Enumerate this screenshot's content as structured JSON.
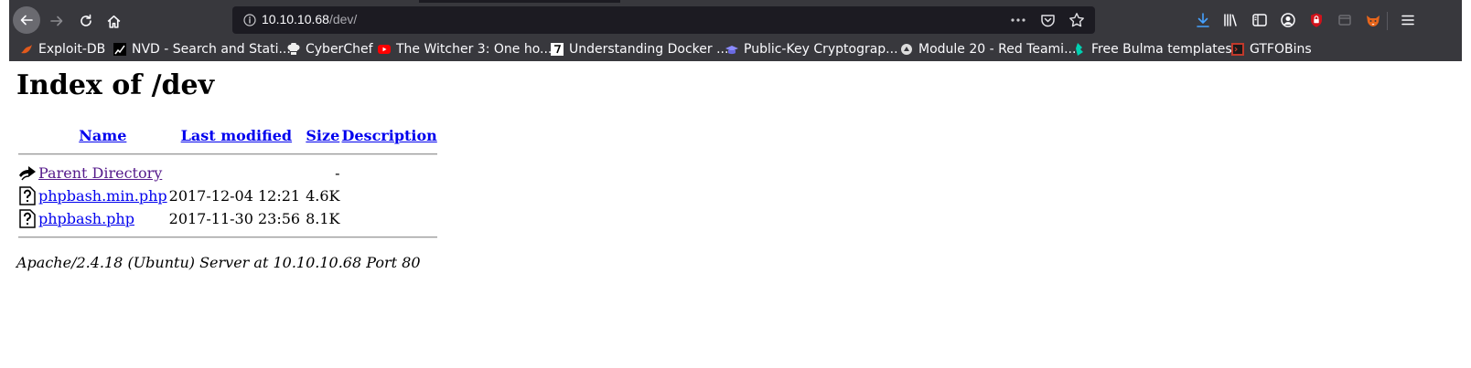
{
  "browser": {
    "url_host": "10.10.10.68",
    "url_path": "/dev/",
    "bookmarks": [
      {
        "label": "Exploit-DB",
        "icon": "exploit-db-icon",
        "color": "#e25a1c"
      },
      {
        "label": "NVD - Search and Stati...",
        "icon": "nvd-icon",
        "color": "#ffffff"
      },
      {
        "label": "CyberChef",
        "icon": "cyberchef-icon",
        "color": "#ffffff"
      },
      {
        "label": "The Witcher 3: One ho...",
        "icon": "youtube-icon",
        "color": "#ff0000"
      },
      {
        "label": "Understanding Docker ...",
        "icon": "medium-icon",
        "color": "#ffffff"
      },
      {
        "label": "Public-Key Cryptograp...",
        "icon": "graduation-cap-icon",
        "color": "#8a8aff"
      },
      {
        "label": "Module 20 - Red Teami...",
        "icon": "module-icon",
        "color": "#dddddd"
      },
      {
        "label": "Free Bulma templates",
        "icon": "bulma-icon",
        "color": "#00d1b2"
      },
      {
        "label": "GTFOBins",
        "icon": "gtfobins-icon",
        "color": "#c0392b"
      }
    ]
  },
  "page": {
    "title": "Index of /dev",
    "columns": {
      "name": "Name",
      "modified": "Last modified",
      "size": "Size",
      "description": "Description"
    },
    "rows": [
      {
        "name": "Parent Directory",
        "modified": "",
        "size": "-",
        "description": "",
        "icon": "back-arrow-icon",
        "visited": true
      },
      {
        "name": "phpbash.min.php",
        "modified": "2017-12-04 12:21",
        "size": "4.6K",
        "description": "",
        "icon": "unknown-file-icon",
        "visited": false
      },
      {
        "name": "phpbash.php",
        "modified": "2017-11-30 23:56",
        "size": "8.1K",
        "description": "",
        "icon": "unknown-file-icon",
        "visited": false
      }
    ],
    "footer": "Apache/2.4.18 (Ubuntu) Server at 10.10.10.68 Port 80"
  }
}
